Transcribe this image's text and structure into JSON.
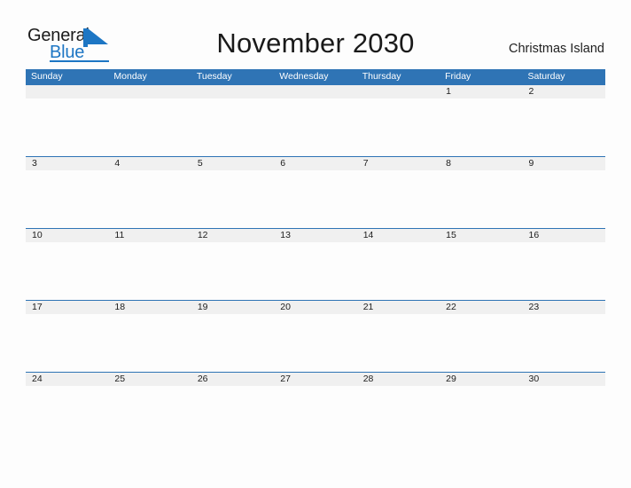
{
  "brand": {
    "name_part1": "General",
    "name_part2": "Blue",
    "flag_icon": "blue-triangle-flag",
    "accent_color": "#1d76c4"
  },
  "header": {
    "title": "November 2030",
    "locale": "Christmas Island"
  },
  "calendar": {
    "month": "November",
    "year": "2030",
    "header_bg_color": "#2f74b5",
    "daynum_band_color": "#f0f0f0",
    "weekday_headers": [
      "Sunday",
      "Monday",
      "Tuesday",
      "Wednesday",
      "Thursday",
      "Friday",
      "Saturday"
    ],
    "weeks": [
      [
        "",
        "",
        "",
        "",
        "",
        "1",
        "2"
      ],
      [
        "3",
        "4",
        "5",
        "6",
        "7",
        "8",
        "9"
      ],
      [
        "10",
        "11",
        "12",
        "13",
        "14",
        "15",
        "16"
      ],
      [
        "17",
        "18",
        "19",
        "20",
        "21",
        "22",
        "23"
      ],
      [
        "24",
        "25",
        "26",
        "27",
        "28",
        "29",
        "30"
      ]
    ]
  }
}
